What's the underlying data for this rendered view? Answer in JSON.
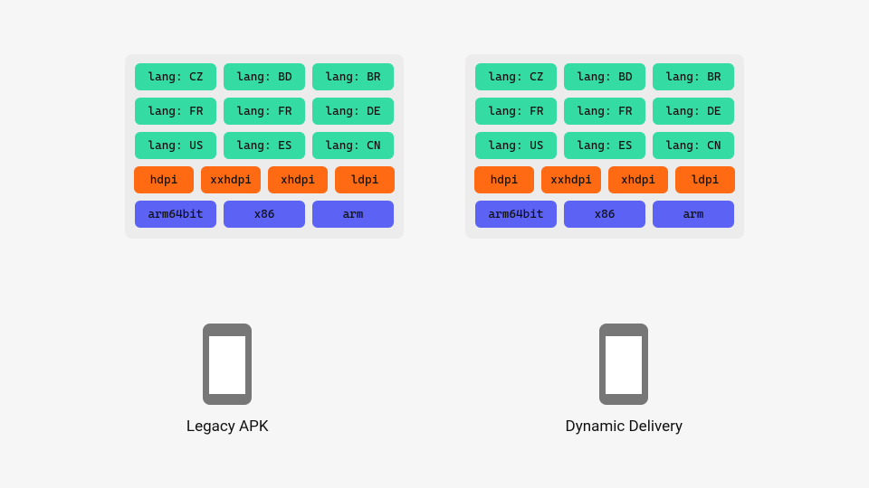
{
  "colors": {
    "bg": "#f6f6f6",
    "panel": "#ececec",
    "lang": "#34dca3",
    "dpi": "#ff6a13",
    "arch": "#5b62f4"
  },
  "panels": {
    "left": {
      "lang_rows": [
        [
          "lang: CZ",
          "lang: BD",
          "lang: BR"
        ],
        [
          "lang: FR",
          "lang: FR",
          "lang: DE"
        ],
        [
          "lang: US",
          "lang: ES",
          "lang: CN"
        ]
      ],
      "dpi_row": [
        "hdpi",
        "xxhdpi",
        "xhdpi",
        "ldpi"
      ],
      "arch_row": [
        "arm64bit",
        "x86",
        "arm"
      ]
    },
    "right": {
      "lang_rows": [
        [
          "lang: CZ",
          "lang: BD",
          "lang: BR"
        ],
        [
          "lang: FR",
          "lang: FR",
          "lang: DE"
        ],
        [
          "lang: US",
          "lang: ES",
          "lang: CN"
        ]
      ],
      "dpi_row": [
        "hdpi",
        "xxhdpi",
        "xhdpi",
        "ldpi"
      ],
      "arch_row": [
        "arm64bit",
        "x86",
        "arm"
      ]
    }
  },
  "phones": {
    "left_label": "Legacy APK",
    "right_label": "Dynamic Delivery"
  }
}
